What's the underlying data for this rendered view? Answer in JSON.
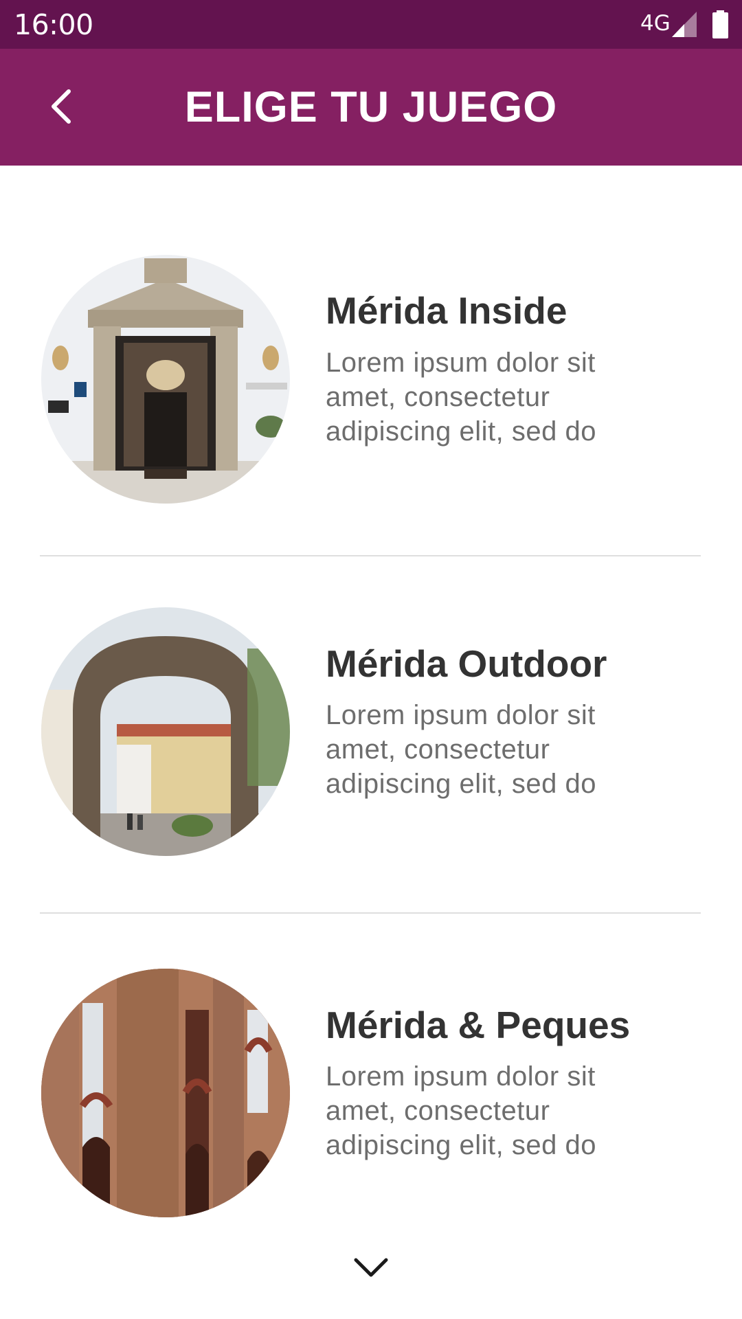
{
  "status_bar": {
    "time": "16:00",
    "network": "4G",
    "signal_icon": "signal-icon",
    "battery_icon": "battery-icon"
  },
  "app_bar": {
    "title": "ELIGE TU JUEGO",
    "back_icon": "chevron-left-icon",
    "background_color": "#852062"
  },
  "games": [
    {
      "title": "Mérida Inside",
      "description": "Lorem ipsum dolor sit amet, consectetur adipiscing elit, sed do",
      "image": "parador-doorway-photo"
    },
    {
      "title": "Mérida Outdoor",
      "description": "Lorem ipsum dolor sit amet, consectetur adipiscing elit, sed do",
      "image": "stone-arch-street-photo"
    },
    {
      "title": "Mérida & Peques",
      "description": "Lorem ipsum dolor sit amet, consectetur adipiscing elit, sed do",
      "image": "aqueduct-brick-arches-photo"
    }
  ],
  "scroll_more_icon": "chevron-down-icon",
  "colors": {
    "status_bar": "#63134f",
    "accent": "#852062",
    "title_text": "#333333",
    "body_text": "#6d6d6d"
  }
}
